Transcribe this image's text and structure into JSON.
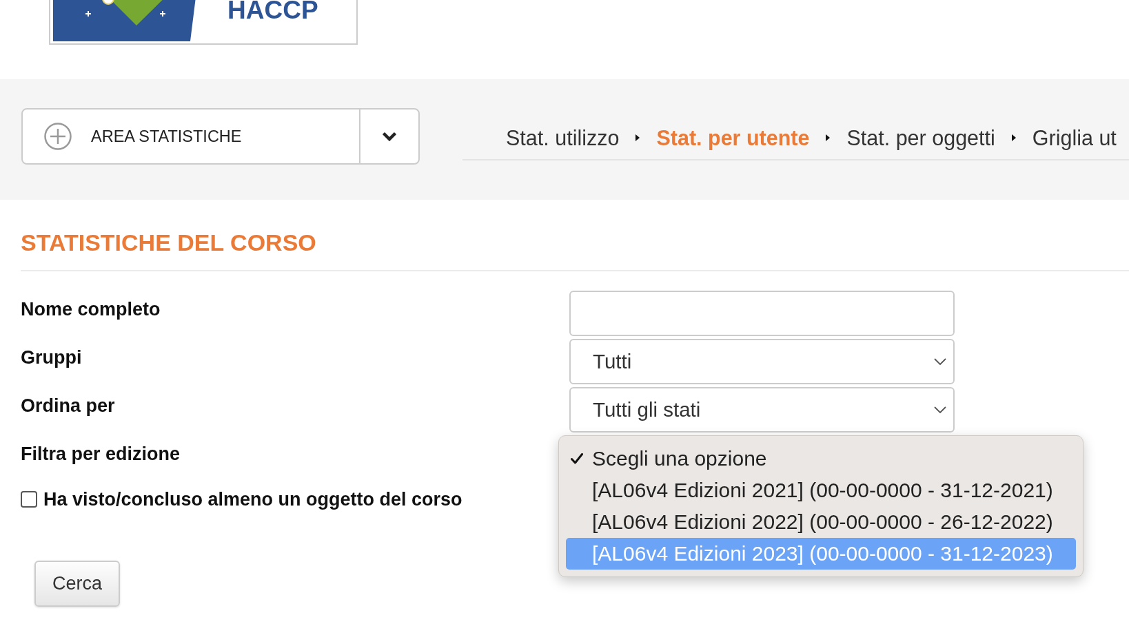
{
  "logo": {
    "text": "HACCP"
  },
  "area_menu": {
    "label": "AREA STATISTICHE"
  },
  "breadcrumb": [
    {
      "label": "Stat. utilizzo",
      "selected": false
    },
    {
      "label": "Stat. per utente",
      "selected": true
    },
    {
      "label": "Stat. per oggetti",
      "selected": false
    },
    {
      "label": "Griglia ut",
      "selected": false
    }
  ],
  "section_title": "STATISTICHE DEL CORSO",
  "form": {
    "fields": [
      {
        "kind": "text",
        "label": "Nome completo"
      },
      {
        "kind": "select",
        "label": "Gruppi",
        "value": "Tutti"
      },
      {
        "kind": "select",
        "label": "Ordina per",
        "value": "Tutti gli stati"
      },
      {
        "kind": "dropdown",
        "label": "Filtra per edizione",
        "options": [
          {
            "label": "Scegli una opzione",
            "checked": true,
            "highlighted": false
          },
          {
            "label": "[AL06v4 Edizioni 2021] (00-00-0000 - 31-12-2021)",
            "checked": false,
            "highlighted": false
          },
          {
            "label": "[AL06v4 Edizioni 2022] (00-00-0000 - 26-12-2022)",
            "checked": false,
            "highlighted": false
          },
          {
            "label": "[AL06v4 Edizioni 2023] (00-00-0000 - 31-12-2023)",
            "checked": false,
            "highlighted": true
          }
        ]
      }
    ],
    "checkbox": {
      "label": "Ha visto/concluso almeno un oggetto del corso",
      "checked": false
    },
    "submit_button": "Cerca"
  }
}
